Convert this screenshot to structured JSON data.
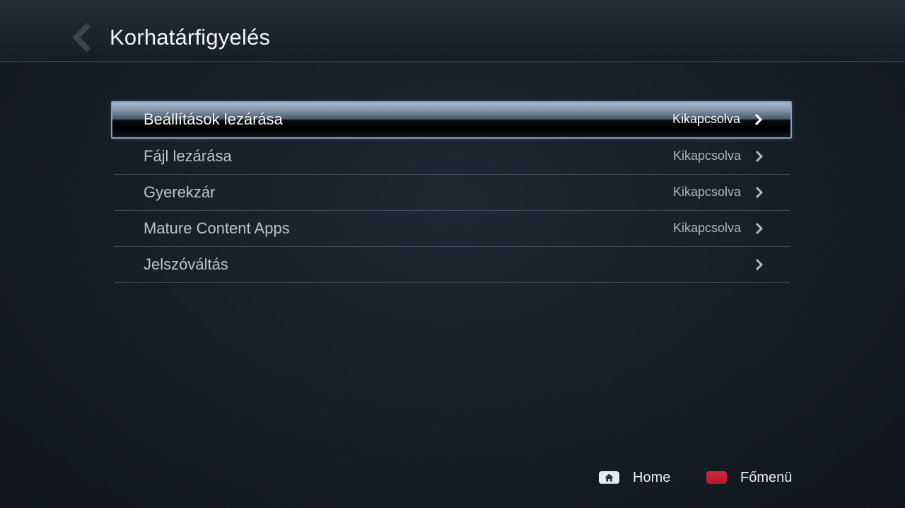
{
  "header": {
    "title": "Korhatárfigyelés",
    "back_icon": "chevron-left-icon"
  },
  "menu": {
    "items": [
      {
        "label": "Beállítások lezárása",
        "status": "Kikapcsolva",
        "selected": true
      },
      {
        "label": "Fájl lezárása",
        "status": "Kikapcsolva",
        "selected": false
      },
      {
        "label": "Gyerekzár",
        "status": "Kikapcsolva",
        "selected": false
      },
      {
        "label": "Mature Content Apps",
        "status": "Kikapcsolva",
        "selected": false
      },
      {
        "label": "Jelszóváltás",
        "status": "",
        "selected": false
      }
    ],
    "item_icon": "chevron-right-icon"
  },
  "footer": {
    "home_label": "Home",
    "home_icon": "home-icon",
    "main_menu_label": "Főmenü",
    "main_menu_key_color": "#c41a33"
  },
  "colors": {
    "accent": "#7f9fc4",
    "background": "#161c25"
  }
}
